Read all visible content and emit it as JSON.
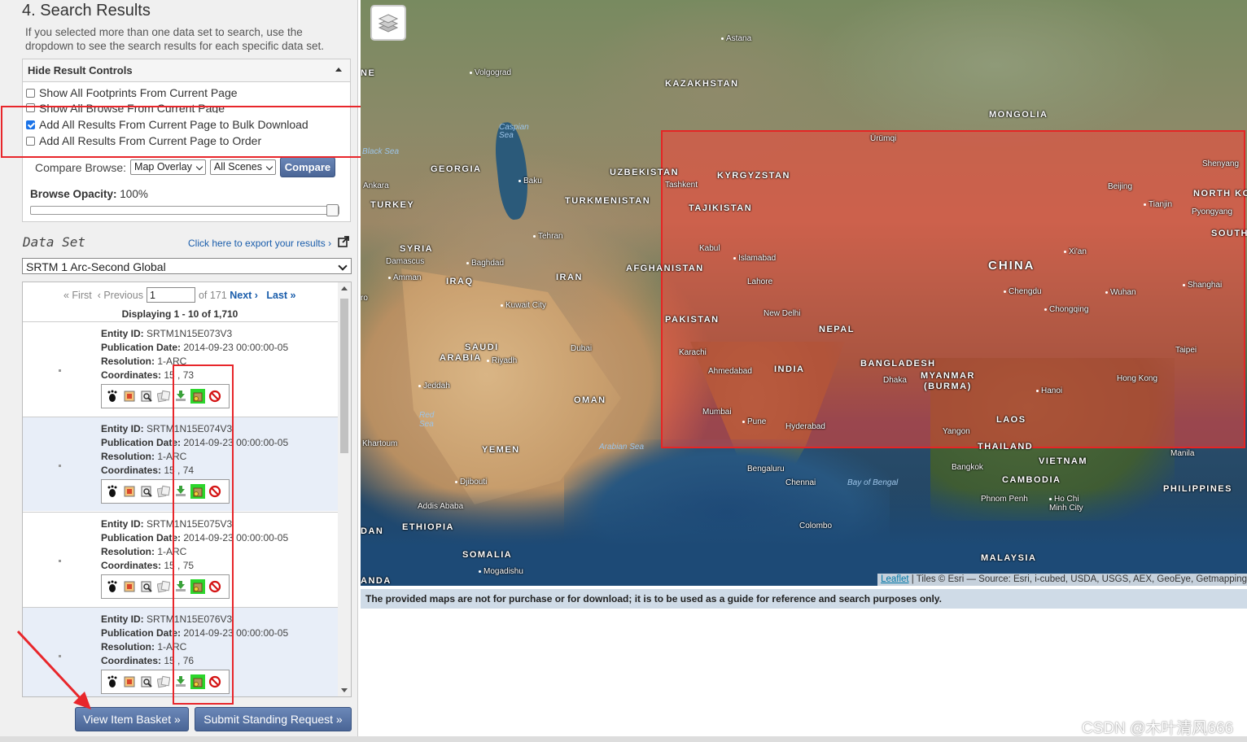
{
  "search_results": {
    "title": "4. Search Results",
    "description": "If you selected more than one data set to search, use the dropdown to see the search results for each specific data set."
  },
  "controls": {
    "header": "Hide Result Controls",
    "options": [
      {
        "label": "Show All Footprints From Current Page",
        "checked": false
      },
      {
        "label": "Show All Browse From Current Page",
        "checked": false
      },
      {
        "label": "Add All Results From Current Page to Bulk Download",
        "checked": true
      },
      {
        "label": "Add All Results From Current Page to Order",
        "checked": false
      }
    ],
    "compare_label": "Compare Browse:",
    "compare_mode": "Map Overlay",
    "compare_scenes": "All Scenes",
    "compare_button": "Compare",
    "opacity_label": "Browse Opacity:",
    "opacity_value": "100%"
  },
  "dataset": {
    "label": "Data Set",
    "export_link": "Click here to export your results ›",
    "selected": "SRTM 1 Arc-Second Global"
  },
  "pager": {
    "first": "« First",
    "previous": "‹ Previous",
    "page": "1",
    "of": "of 171",
    "next": "Next ›",
    "last": "Last »",
    "displaying": "Displaying 1 - 10 of 1,710"
  },
  "results": [
    {
      "entity_label": "Entity ID:",
      "entity": "SRTM1N15E073V3",
      "pub_label": "Publication Date:",
      "pub": "2014-09-23 00:00:00-05",
      "res_label": "Resolution:",
      "res": "1-ARC",
      "coord_label": "Coordinates:",
      "coord": "15 , 73"
    },
    {
      "entity_label": "Entity ID:",
      "entity": "SRTM1N15E074V3",
      "pub_label": "Publication Date:",
      "pub": "2014-09-23 00:00:00-05",
      "res_label": "Resolution:",
      "res": "1-ARC",
      "coord_label": "Coordinates:",
      "coord": "15 , 74"
    },
    {
      "entity_label": "Entity ID:",
      "entity": "SRTM1N15E075V3",
      "pub_label": "Publication Date:",
      "pub": "2014-09-23 00:00:00-05",
      "res_label": "Resolution:",
      "res": "1-ARC",
      "coord_label": "Coordinates:",
      "coord": "15 , 75"
    },
    {
      "entity_label": "Entity ID:",
      "entity": "SRTM1N15E076V3",
      "pub_label": "Publication Date:",
      "pub": "2014-09-23 00:00:00-05",
      "res_label": "Resolution:",
      "res": "1-ARC",
      "coord_label": "Coordinates:",
      "coord": "15 , 76"
    }
  ],
  "tool_icons": [
    "footprint-icon",
    "browse-overlay-icon",
    "metadata-icon",
    "compare-icon",
    "download-icon",
    "bulk-download-icon",
    "exclude-icon"
  ],
  "buttons": {
    "basket": "View Item Basket »",
    "standing": "Submit Standing Request »"
  },
  "map": {
    "labels": {
      "astana": "Astana",
      "kazakhstan": "KAZAKHSTAN",
      "mongolia": "MONGOLIA",
      "volgograd": "Volgograd",
      "ne": "NE",
      "caspian": "Caspian Sea",
      "black_sea": "Black Sea",
      "georgia": "GEORGIA",
      "uzbekistan": "UZBEKISTAN",
      "kyrgyzstan": "KYRGYZSTAN",
      "tashkent": "Tashkent",
      "urumqi": "Ürümqi",
      "shenyang": "Shenyang",
      "north_korea": "NORTH KO",
      "beijing": "Beijing",
      "tianjin": "Tianjin",
      "pyongyang": "Pyongyang",
      "south": "SOUTH",
      "ankara": "Ankara",
      "baku": "Baku",
      "turkey": "TURKEY",
      "turkmenistan": "TURKMENISTAN",
      "tajikistan": "TAJIKISTAN",
      "tehran": "Tehran",
      "syria": "SYRIA",
      "damascus": "Damascus",
      "baghdad": "Baghdad",
      "amman": "Amman",
      "iraq": "IRAQ",
      "iran": "IRAN",
      "afghanistan": "AFGHANISTAN",
      "kabul": "Kabul",
      "islamabad": "Islamabad",
      "lahore": "Lahore",
      "china": "CHINA",
      "xian": "Xi'an",
      "shanghai": "Shanghai",
      "chengdu": "Chengdu",
      "wuhan": "Wuhan",
      "chongqing": "Chongqing",
      "kuwait": "Kuwait City",
      "new_delhi": "New Delhi",
      "pakistan": "PAKISTAN",
      "nepal": "NEPAL",
      "saudi": "SAUDI",
      "arabia": "ARABIA",
      "riyadh": "Riyadh",
      "dubai": "Dubai",
      "karachi": "Karachi",
      "bangladesh": "BANGLADESH",
      "taipei": "Taipei",
      "ahmedabad": "Ahmedabad",
      "india": "INDIA",
      "dhaka": "Dhaka",
      "myanmar": "MYANMAR",
      "burma": "(BURMA)",
      "hong_kong": "Hong Kong",
      "jeddah": "Jeddah",
      "oman": "OMAN",
      "hanoi": "Hanoi",
      "red_sea": "Red Sea",
      "mumbai": "Mumbai",
      "pune": "Pune",
      "hyderabad": "Hyderabad",
      "laos": "LAOS",
      "khartoum": "Khartoum",
      "arabian_sea": "Arabian Sea",
      "yemen": "YEMEN",
      "yangon": "Yangon",
      "thailand": "THAILAND",
      "manila": "Manila",
      "vietnam": "VIETNAM",
      "bengaluru": "Bengaluru",
      "bangkok": "Bangkok",
      "djibouti": "Djibouti",
      "chennai": "Chennai",
      "bay_of_bengal": "Bay of Bengal",
      "cambodia": "CAMBODIA",
      "philippines": "PHILIPPINES",
      "addis": "Addis Ababa",
      "phnom_penh": "Phnom Penh",
      "hcmc": "Ho Chi Minh City",
      "ethiopia": "ETHIOPIA",
      "colombo": "Colombo",
      "dan": "DAN",
      "somalia": "SOMALIA",
      "malaysia": "MALAYSIA",
      "mogadishu": "Mogadishu",
      "anda": "ANDA",
      "ro": "ro"
    },
    "attribution_link": "Leaflet",
    "attribution_text": " | Tiles © Esri — Source: Esri, i-cubed, USDA, USGS, AEX, GeoEye, Getmapping"
  },
  "disclaimer": "The provided maps are not for purchase or for download; it is to be used as a guide for reference and search purposes only.",
  "watermark": "CSDN @木叶清风666"
}
